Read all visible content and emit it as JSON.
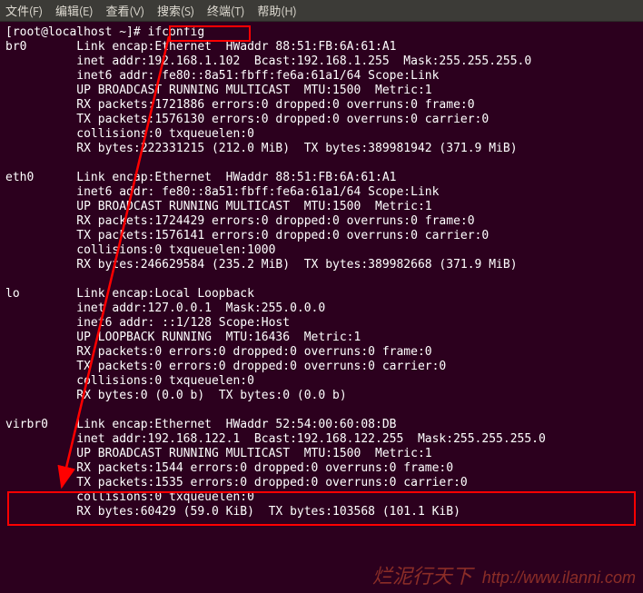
{
  "menubar": {
    "file": "文件(F)",
    "edit": "编辑(E)",
    "view": "查看(V)",
    "search": "搜索(S)",
    "terminal": "终端(T)",
    "help": "帮助(H)"
  },
  "prompt": "[root@localhost ~]# ",
  "command": "ifconfig",
  "interfaces": [
    {
      "name": "br0",
      "lines": [
        "Link encap:Ethernet  HWaddr 88:51:FB:6A:61:A1",
        "inet addr:192.168.1.102  Bcast:192.168.1.255  Mask:255.255.255.0",
        "inet6 addr: fe80::8a51:fbff:fe6a:61a1/64 Scope:Link",
        "UP BROADCAST RUNNING MULTICAST  MTU:1500  Metric:1",
        "RX packets:1721886 errors:0 dropped:0 overruns:0 frame:0",
        "TX packets:1576130 errors:0 dropped:0 overruns:0 carrier:0",
        "collisions:0 txqueuelen:0",
        "RX bytes:222331215 (212.0 MiB)  TX bytes:389981942 (371.9 MiB)"
      ]
    },
    {
      "name": "eth0",
      "lines": [
        "Link encap:Ethernet  HWaddr 88:51:FB:6A:61:A1",
        "inet6 addr: fe80::8a51:fbff:fe6a:61a1/64 Scope:Link",
        "UP BROADCAST RUNNING MULTICAST  MTU:1500  Metric:1",
        "RX packets:1724429 errors:0 dropped:0 overruns:0 frame:0",
        "TX packets:1576141 errors:0 dropped:0 overruns:0 carrier:0",
        "collisions:0 txqueuelen:1000",
        "RX bytes:246629584 (235.2 MiB)  TX bytes:389982668 (371.9 MiB)"
      ]
    },
    {
      "name": "lo",
      "lines": [
        "Link encap:Local Loopback",
        "inet addr:127.0.0.1  Mask:255.0.0.0",
        "inet6 addr: ::1/128 Scope:Host",
        "UP LOOPBACK RUNNING  MTU:16436  Metric:1",
        "RX packets:0 errors:0 dropped:0 overruns:0 frame:0",
        "TX packets:0 errors:0 dropped:0 overruns:0 carrier:0",
        "collisions:0 txqueuelen:0",
        "RX bytes:0 (0.0 b)  TX bytes:0 (0.0 b)"
      ]
    },
    {
      "name": "virbr0",
      "lines": [
        "Link encap:Ethernet  HWaddr 52:54:00:60:08:DB",
        "inet addr:192.168.122.1  Bcast:192.168.122.255  Mask:255.255.255.0",
        "UP BROADCAST RUNNING MULTICAST  MTU:1500  Metric:1",
        "RX packets:1544 errors:0 dropped:0 overruns:0 frame:0",
        "TX packets:1535 errors:0 dropped:0 overruns:0 carrier:0",
        "collisions:0 txqueuelen:0",
        "RX bytes:60429 (59.0 KiB)  TX bytes:103568 (101.1 KiB)"
      ]
    }
  ],
  "watermark": {
    "cn": "烂泥行天下",
    "url": "http://www.ilanni.com"
  },
  "annotation_colors": {
    "highlight_box": "#ff0000",
    "arrow": "#ff0000"
  }
}
